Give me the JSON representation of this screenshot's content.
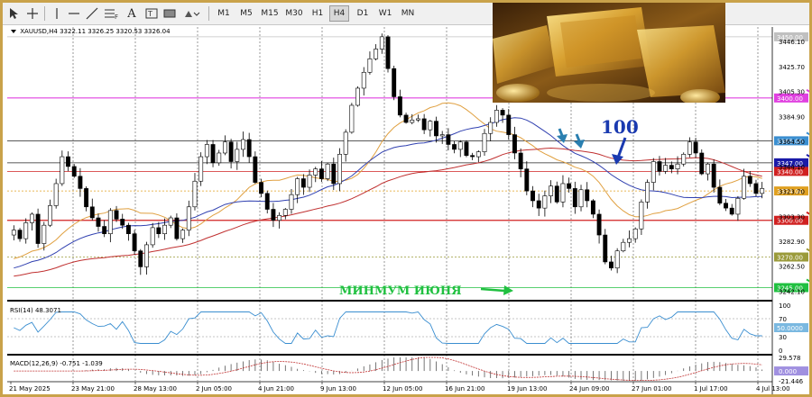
{
  "toolbar": {
    "timeframes": [
      "M1",
      "M5",
      "M15",
      "M30",
      "H1",
      "H4",
      "D1",
      "W1",
      "MN"
    ],
    "active_timeframe": "H4"
  },
  "header": {
    "symbol": "XAUUSD,H4",
    "ohlc": "3322.11 3326.25 3320.53 3326.04"
  },
  "chart_data": [
    {
      "type": "candlestick",
      "symbol": "XAUUSD",
      "timeframe": "H4",
      "price_ticks": [
        "3446.10",
        "3425.70",
        "3405.30",
        "3384.90",
        "3364.50",
        "3344.10",
        "3323.70",
        "3303.30",
        "3282.90",
        "3262.50",
        "3242.10"
      ],
      "ylim": [
        3238,
        3458
      ],
      "date_labels": [
        "21 May 2025",
        "23 May 21:00",
        "28 May 13:00",
        "2 Jun 05:00",
        "4 Jun 21:00",
        "9 Jun 13:00",
        "12 Jun 05:00",
        "16 Jun 21:00",
        "19 Jun 13:00",
        "24 Jun 09:00",
        "27 Jun 01:00",
        "1 Jul 17:00",
        "4 Jul 13:00"
      ],
      "horizontal_levels": [
        {
          "price": 3450.0,
          "label": "3450.00",
          "color": "#c0c0c0"
        },
        {
          "price": 3400.0,
          "label": "3400.00",
          "color": "#e040e0"
        },
        {
          "price": 3365.0,
          "label": "3365.00",
          "color": "#3a8ed0"
        },
        {
          "price": 3347.0,
          "label": "3347.00",
          "color": "#1a1aa8"
        },
        {
          "price": 3340.0,
          "label": "3340.00",
          "color": "#d02020"
        },
        {
          "price": 3324.0,
          "label": "3324.00",
          "color": "#e0a020"
        },
        {
          "price": 3300.0,
          "label": "3300.00",
          "color": "#d02020"
        },
        {
          "price": 3270.0,
          "label": "3270.00",
          "color": "#9a9a3a"
        },
        {
          "price": 3245.0,
          "label": "3245.00",
          "color": "#20c040"
        }
      ],
      "closes": [
        3292,
        3285,
        3298,
        3305,
        3281,
        3296,
        3312,
        3330,
        3352,
        3344,
        3336,
        3326,
        3311,
        3302,
        3295,
        3289,
        3308,
        3301,
        3296,
        3289,
        3275,
        3262,
        3280,
        3294,
        3289,
        3296,
        3302,
        3285,
        3292,
        3311,
        3332,
        3352,
        3362,
        3347,
        3355,
        3364,
        3348,
        3358,
        3366,
        3352,
        3331,
        3322,
        3309,
        3300,
        3304,
        3309,
        3321,
        3334,
        3327,
        3337,
        3342,
        3334,
        3346,
        3330,
        3354,
        3372,
        3394,
        3408,
        3421,
        3432,
        3440,
        3450,
        3424,
        3401,
        3386,
        3380,
        3382,
        3383,
        3374,
        3381,
        3369,
        3370,
        3362,
        3358,
        3364,
        3353,
        3352,
        3356,
        3371,
        3380,
        3390,
        3386,
        3370,
        3355,
        3342,
        3324,
        3316,
        3310,
        3320,
        3328,
        3315,
        3330,
        3326,
        3311,
        3325,
        3316,
        3305,
        3288,
        3266,
        3261,
        3275,
        3282,
        3285,
        3293,
        3315,
        3331,
        3348,
        3340,
        3345,
        3342,
        3346,
        3354,
        3364,
        3355,
        3338,
        3346,
        3327,
        3314,
        3310,
        3305,
        3318,
        3336,
        3330,
        3322,
        3326
      ]
    },
    {
      "type": "line",
      "name": "RSI(14)",
      "value_label": "48.3071",
      "levels": [
        "100",
        "70",
        "50",
        "30",
        "0"
      ],
      "current": "50.0000",
      "ylim": [
        0,
        100
      ]
    },
    {
      "type": "bar",
      "name": "MACD(12,26,9)",
      "value_label": "-0.751 -1.039",
      "axis_labels": [
        "29.578",
        "0.000",
        "-21.446"
      ],
      "ylim": [
        -21.446,
        29.578
      ]
    }
  ],
  "annotations": {
    "june_low": "МИНМУМ ИЮНЯ",
    "ma_period": "100"
  },
  "colors": {
    "candle": "#000000",
    "ma_fast": "#e0a040",
    "ma_mid": "#3040b0",
    "ma_slow": "#c03030",
    "rsi_line": "#3a8ed0",
    "annot_green": "#20c040",
    "annot_blue": "#1a3ab0"
  }
}
